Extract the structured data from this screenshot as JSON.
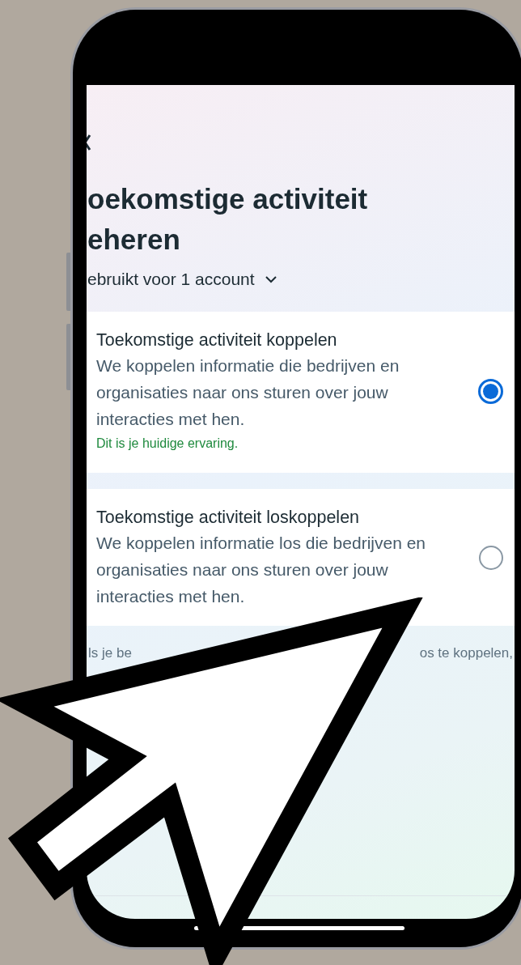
{
  "header": {
    "title_lines": [
      "oekomstige activiteit",
      "eheren"
    ],
    "account_selector": "ebruikt voor 1 account"
  },
  "options": [
    {
      "title": "Toekomstige activiteit koppelen",
      "description": "We koppelen informatie die bedrijven en organisaties naar ons sturen over jouw interacties met hen.",
      "note": "Dit is je huidige ervaring.",
      "selected": true
    },
    {
      "title": "Toekomstige activiteit loskoppelen",
      "description": "We koppelen informatie los die bedrijven en organisaties naar ons sturen over jouw interacties met hen.",
      "selected": false
    }
  ],
  "footer_fragments": [
    "ls je be",
    "os te koppelen,"
  ]
}
